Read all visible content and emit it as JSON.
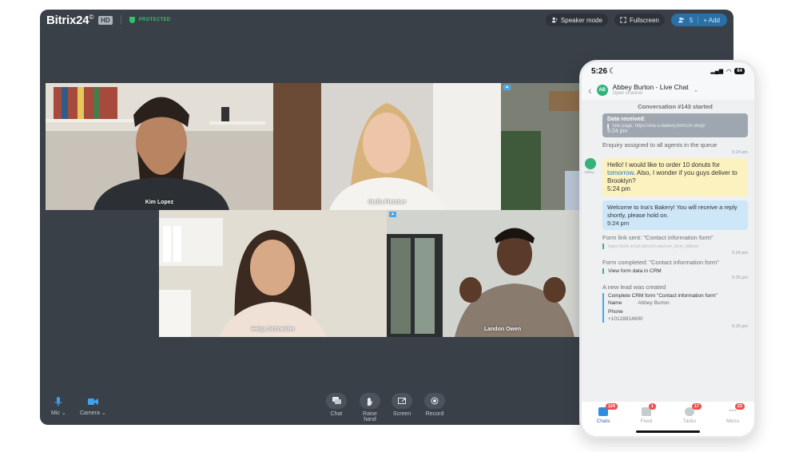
{
  "app": {
    "brand": "Bitrix24",
    "brand_mark": "©",
    "hd_badge": "HD",
    "protected_label": "PROTECTED",
    "speaker_mode": "Speaker mode",
    "fullscreen": "Fullscreen",
    "users_count": "5",
    "add_label": "+ Add"
  },
  "tiles": [
    {
      "name": "Kim Lopez"
    },
    {
      "name": "Stella Fletcher"
    },
    {
      "name": ""
    },
    {
      "name": "Helga Schneider"
    },
    {
      "name": "Landon Owen"
    }
  ],
  "controls": {
    "mic": "Mic",
    "camera": "Camera",
    "chat": "Chat",
    "raise_hand": "Raise hand",
    "screen": "Screen",
    "record": "Record"
  },
  "phone": {
    "time": "5:26",
    "battery": "64",
    "contact_initials": "AB",
    "contact_name": "Abbey Burton - Live Chat",
    "contact_sub": "Open channel",
    "conversation_started": "Conversation #143 started",
    "data_received_title": "Data received:",
    "site_page": "Site page: https://ina-s-bakery.bitrix24.shop/",
    "t1": "5:24 pm",
    "enquiry": "Enquiry assigned to all agents in the queue",
    "t2": "5:24 pm",
    "avatar_label": "Abbey",
    "customer_msg_part1": "Hello! I would like to order 10 donuts for",
    "customer_msg_link": "tomorrow",
    "customer_msg_part2": ". Also, I wonder if you guys deliver to Brooklyn?",
    "t3": "5:24 pm",
    "reply": "Welcome to Ina's Bakery! You will receive a reply shortly, please hold on.",
    "t4": "5:24 pm",
    "form_link_title": "Form link sent: \"Contact information form\"",
    "form_link_url": "https://b24-ar1ef.bitrix24.site/crm_form_fd8ew/",
    "t5": "5:24 pm",
    "form_completed_title": "Form completed: \"Contact information form\"",
    "view_form": "View form data in CRM",
    "t6": "5:25 pm",
    "lead_created": "A new lead was created",
    "complete_crm": "Complete CRM form \"Contact information form\"",
    "name_label": "Name",
    "name_value": "Abbey Burton",
    "phone_label": "Phone",
    "phone_value": "+10128814690",
    "t7": "5:25 pm",
    "tabs": [
      {
        "label": "Chats",
        "count": "124"
      },
      {
        "label": "Feed",
        "count": "1"
      },
      {
        "label": "Tasks",
        "count": "17"
      },
      {
        "label": "Menu",
        "count": "23"
      }
    ]
  }
}
